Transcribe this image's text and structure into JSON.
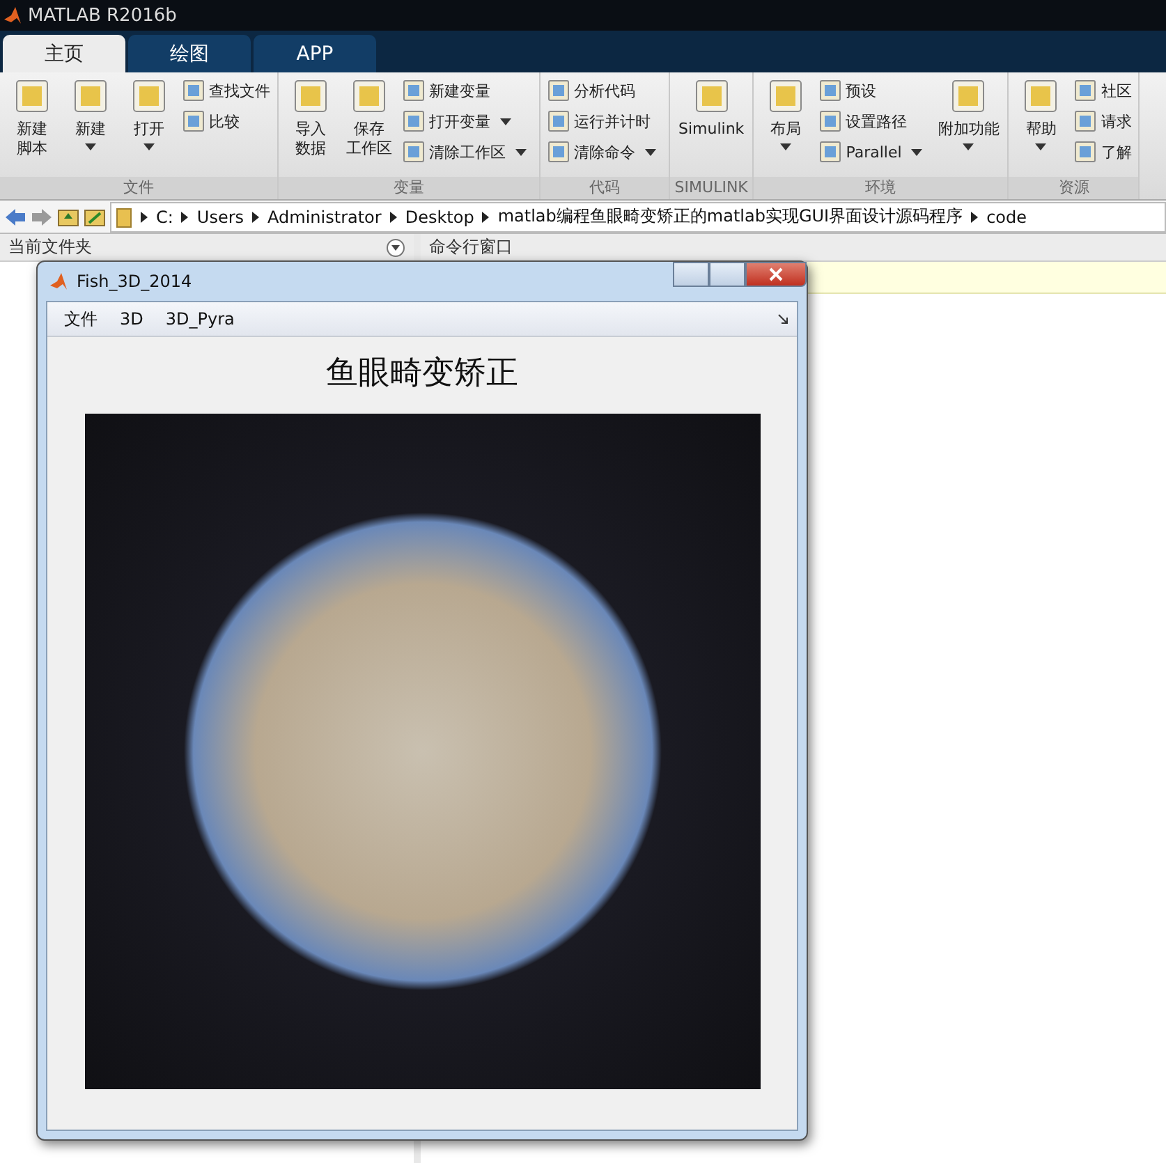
{
  "window": {
    "title": "MATLAB R2016b"
  },
  "tabs": [
    {
      "label": "主页",
      "selected": true
    },
    {
      "label": "绘图",
      "selected": false
    },
    {
      "label": "APP",
      "selected": false
    }
  ],
  "ribbon": [
    {
      "label": "文件",
      "items": [
        {
          "kind": "large",
          "lines": [
            "新建",
            "脚本"
          ],
          "dropdown": false
        },
        {
          "kind": "large",
          "lines": [
            "新建"
          ],
          "dropdown": true
        },
        {
          "kind": "large",
          "lines": [
            "打开"
          ],
          "dropdown": true
        },
        {
          "kind": "column",
          "entries": [
            {
              "label": "查找文件",
              "dropdown": false
            },
            {
              "label": "比较",
              "dropdown": false
            }
          ]
        }
      ]
    },
    {
      "label": "变量",
      "items": [
        {
          "kind": "large",
          "lines": [
            "导入",
            "数据"
          ],
          "dropdown": false
        },
        {
          "kind": "large",
          "lines": [
            "保存",
            "工作区"
          ],
          "dropdown": false
        },
        {
          "kind": "column",
          "entries": [
            {
              "label": "新建变量",
              "dropdown": false
            },
            {
              "label": "打开变量",
              "dropdown": true
            },
            {
              "label": "清除工作区",
              "dropdown": true
            }
          ]
        }
      ]
    },
    {
      "label": "代码",
      "items": [
        {
          "kind": "column",
          "entries": [
            {
              "label": "分析代码",
              "dropdown": false
            },
            {
              "label": "运行并计时",
              "dropdown": false
            },
            {
              "label": "清除命令",
              "dropdown": true
            }
          ]
        }
      ]
    },
    {
      "label": "SIMULINK",
      "items": [
        {
          "kind": "large",
          "lines": [
            "Simulink"
          ],
          "dropdown": false
        }
      ]
    },
    {
      "label": "环境",
      "items": [
        {
          "kind": "large",
          "lines": [
            "布局"
          ],
          "dropdown": true
        },
        {
          "kind": "column",
          "entries": [
            {
              "label": "预设",
              "dropdown": false
            },
            {
              "label": "设置路径",
              "dropdown": false
            },
            {
              "label": "Parallel",
              "dropdown": true
            }
          ]
        },
        {
          "kind": "large",
          "lines": [
            "附加功能"
          ],
          "dropdown": true
        }
      ]
    },
    {
      "label": "资源",
      "items": [
        {
          "kind": "large",
          "lines": [
            "帮助"
          ],
          "dropdown": true
        },
        {
          "kind": "column",
          "entries": [
            {
              "label": "社区",
              "dropdown": false
            },
            {
              "label": "请求",
              "dropdown": false
            },
            {
              "label": "了解",
              "dropdown": false
            }
          ]
        }
      ]
    }
  ],
  "path": [
    "C:",
    "Users",
    "Administrator",
    "Desktop",
    "matlab编程鱼眼畸变矫正的matlab实现GUI界面设计源码程序",
    "code"
  ],
  "left_panel": {
    "title": "当前文件夹"
  },
  "command_window": {
    "title": "命令行窗口"
  },
  "figure": {
    "title": "Fish_3D_2014",
    "menu": [
      "文件",
      "3D",
      "3D_Pyra"
    ],
    "axes_title": "鱼眼畸变矫正"
  }
}
